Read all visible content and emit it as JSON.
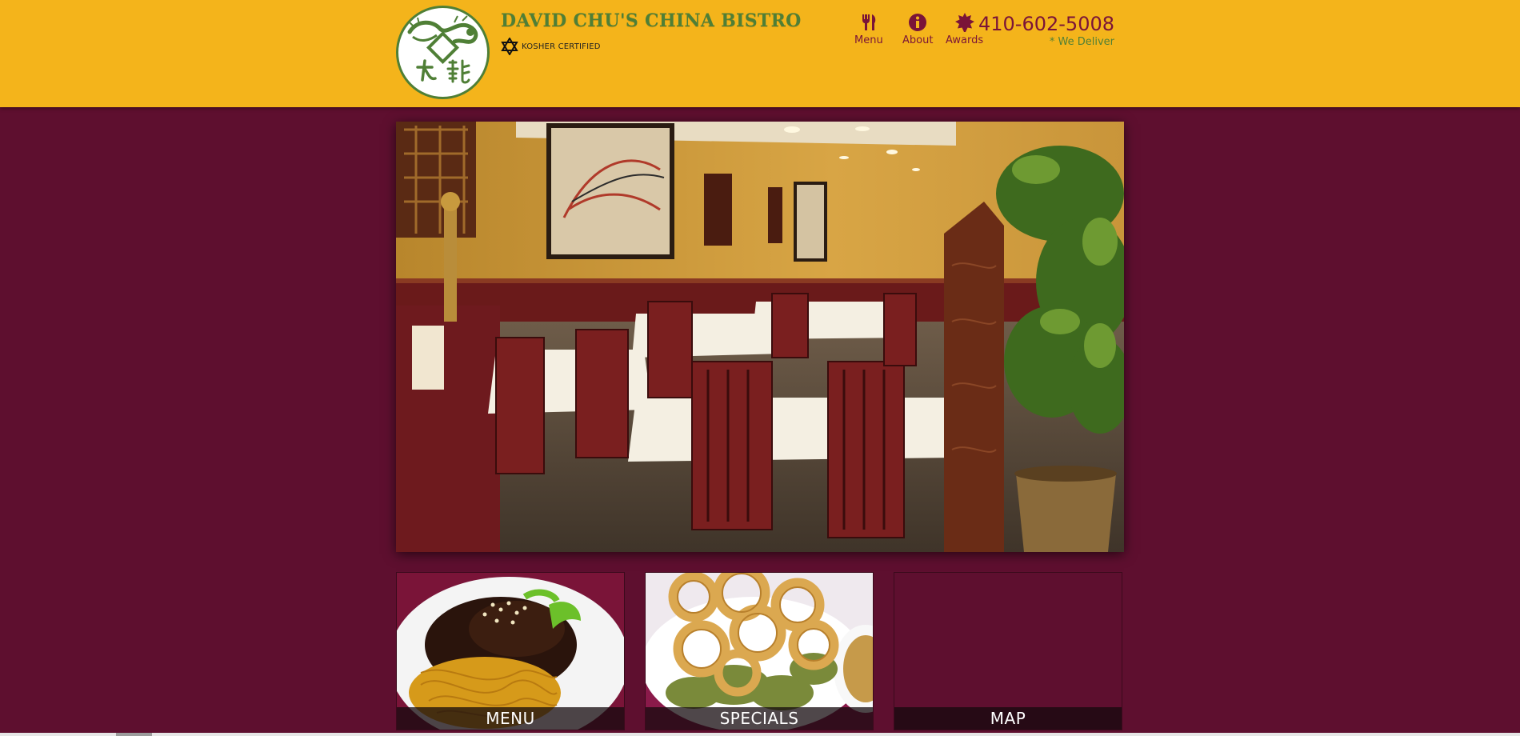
{
  "header": {
    "brand_title": "DAVID CHU'S CHINA BISTRO",
    "kosher_label": "KOSHER CERTIFIED",
    "phone": "410-602-5008",
    "deliver": "* We Deliver"
  },
  "nav": [
    {
      "label": "Menu",
      "icon": "fork-knife-icon"
    },
    {
      "label": "About",
      "icon": "info-icon"
    },
    {
      "label": "Awards",
      "icon": "award-badge-icon"
    }
  ],
  "tiles": [
    {
      "label": "MENU"
    },
    {
      "label": "SPECIALS"
    },
    {
      "label": "MAP"
    }
  ],
  "colors": {
    "header_bg": "#f4b41b",
    "page_bg": "#5e0f2f",
    "brand_green": "#4f7f36",
    "accent_maroon": "#7a1438"
  }
}
